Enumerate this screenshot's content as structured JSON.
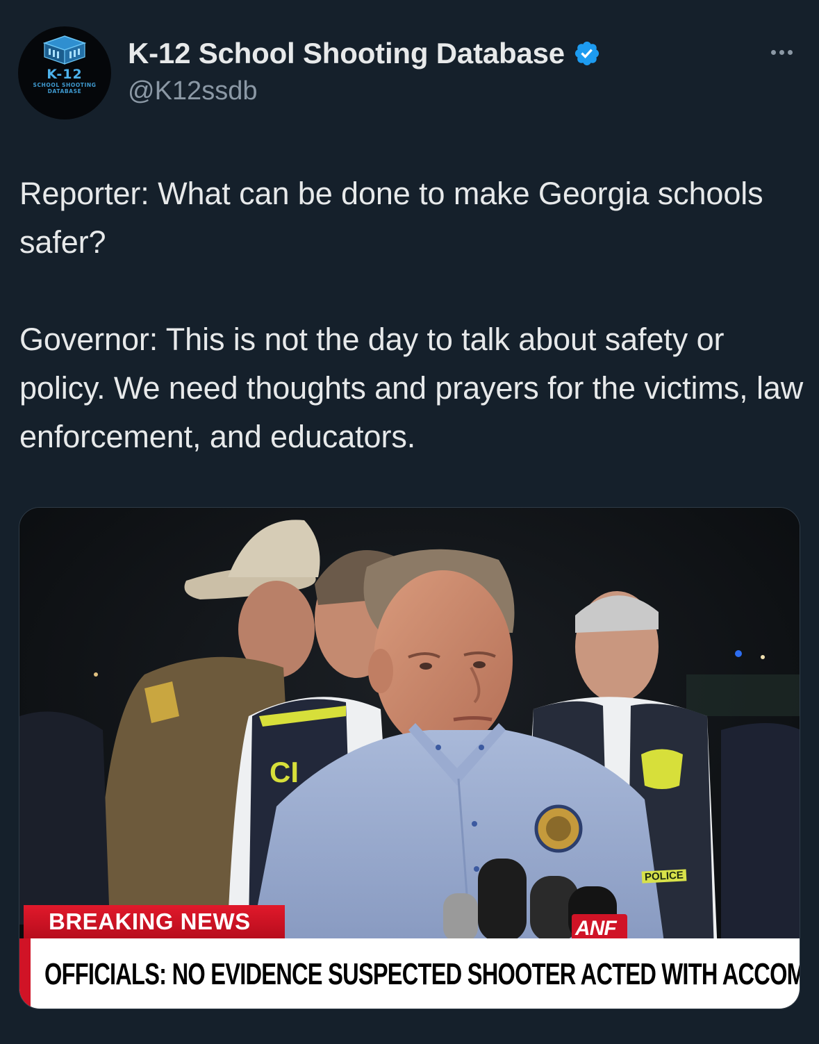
{
  "account": {
    "display_name": "K-12 School Shooting Database",
    "handle": "@K12ssdb",
    "verified": true,
    "avatar": {
      "title": "K-12",
      "subtitle_line1": "SCHOOL SHOOTING",
      "subtitle_line2": "DATABASE"
    }
  },
  "icons": {
    "verified": "verified-badge-icon",
    "more": "more-options-icon"
  },
  "tweet": {
    "paragraphs": [
      "Reporter: What can be done to make Georgia schools safer?",
      "Governor: This is not the day to talk about safety or policy. We need thoughts and prayers for the victims, law enforcement, and educators."
    ]
  },
  "media": {
    "breaking_label": "BREAKING NEWS",
    "headline": "OFFICIALS: NO EVIDENCE SUSPECTED SHOOTER ACTED WITH ACCOMPLICE",
    "mic_logo": "ANF",
    "vest_label": "POLICE"
  },
  "colors": {
    "background": "#15202b",
    "text_primary": "#e7e9ea",
    "text_secondary": "#8b98a5",
    "verified_blue": "#1d9bf0",
    "breaking_red": "#d01326"
  }
}
